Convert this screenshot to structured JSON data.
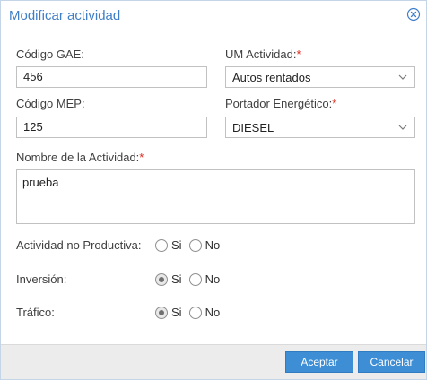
{
  "dialog": {
    "title": "Modificar actividad",
    "close_icon": "close-circle-icon"
  },
  "form": {
    "codigo_gae": {
      "label": "Código GAE:",
      "value": "456"
    },
    "codigo_mep": {
      "label": "Código MEP:",
      "value": "125"
    },
    "um_actividad": {
      "label": "UM Actividad:",
      "required_mark": "*",
      "value": "Autos rentados",
      "icon": "chevron-down-icon"
    },
    "portador": {
      "label": "Portador Energético:",
      "required_mark": "*",
      "value": "DIESEL",
      "icon": "chevron-down-icon"
    },
    "nombre": {
      "label": "Nombre de la Actividad:",
      "required_mark": "*",
      "value": "prueba"
    },
    "actividad_no_productiva": {
      "label": "Actividad no Productiva:",
      "yes": "Si",
      "no": "No",
      "selected": "none"
    },
    "inversion": {
      "label": "Inversión:",
      "yes": "Si",
      "no": "No",
      "selected": "Si"
    },
    "trafico": {
      "label": "Tráfico:",
      "yes": "Si",
      "no": "No",
      "selected": "Si"
    }
  },
  "footer": {
    "accept_label": "Aceptar",
    "cancel_label": "Cancelar"
  },
  "colors": {
    "accent": "#3e8ed6",
    "title": "#3f7ec8",
    "required": "#e0271a"
  }
}
